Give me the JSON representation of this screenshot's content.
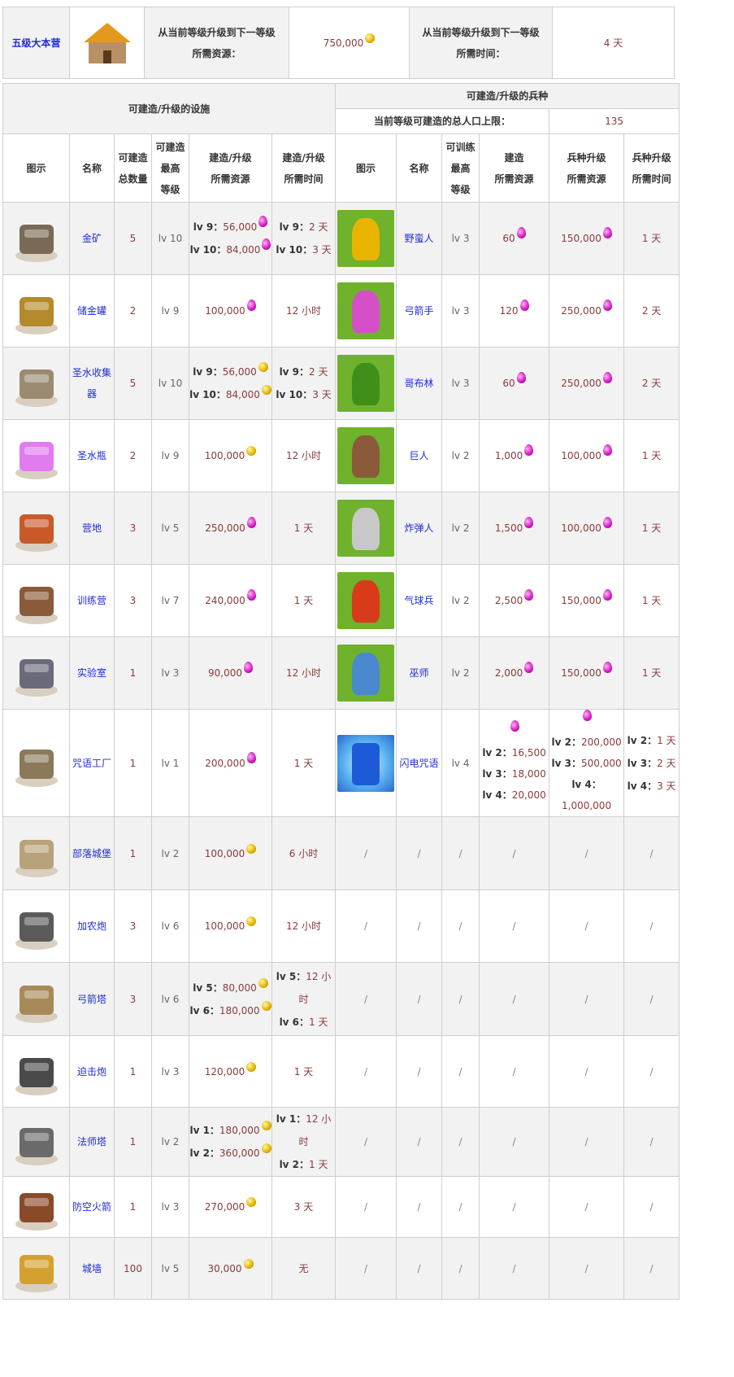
{
  "header": {
    "town_hall": "五级大本营",
    "res_label_1": "从当前等级升级到下一等级",
    "res_label_2": "所需资源：",
    "res_value": "750,000",
    "time_label_1": "从当前等级升级到下一等级",
    "time_label_2": "所需时间：",
    "time_value": "4 天"
  },
  "sections": {
    "facilities": "可建造/升级的设施",
    "troops": "可建造/升级的兵种",
    "pop_label": "当前等级可建造的总人口上限：",
    "pop_value": "135"
  },
  "columns": {
    "icon": "图示",
    "name": "名称",
    "count_1": "可建造",
    "count_2": "总数量",
    "max_1": "可建造",
    "max_2": "最高",
    "max_3": "等级",
    "cost_1": "建造/升级",
    "cost_2": "所需资源",
    "time_1": "建造/升级",
    "time_2": "所需时间",
    "t_icon": "图示",
    "t_name": "名称",
    "t_max_1": "可训练",
    "t_max_2": "最高",
    "t_max_3": "等级",
    "t_build_1": "建造",
    "t_build_2": "所需资源",
    "t_up_1": "兵种升级",
    "t_up_2": "所需资源",
    "t_time_1": "兵种升级",
    "t_time_2": "所需时间"
  },
  "rows": [
    {
      "name": "金矿",
      "count": "5",
      "max": "lv 10",
      "cost": [
        {
          "lv": "lv 9：",
          "v": "56,000",
          "r": "elixir"
        },
        {
          "lv": "lv 10：",
          "v": "84,000",
          "r": "elixir"
        }
      ],
      "time": [
        {
          "lv": "lv 9：",
          "v": "2 天"
        },
        {
          "lv": "lv 10：",
          "v": "3 天"
        }
      ],
      "troop": {
        "name": "野蛮人",
        "max": "lv 3",
        "build": "60",
        "up": "150,000",
        "time": "1 天",
        "fig": "#e8b400"
      }
    },
    {
      "name": "储金罐",
      "count": "2",
      "max": "lv 9",
      "cost": [
        {
          "v": "100,000",
          "r": "elixir"
        }
      ],
      "time": [
        {
          "v": "12 小时"
        }
      ],
      "troop": {
        "name": "弓箭手",
        "max": "lv 3",
        "build": "120",
        "up": "250,000",
        "time": "2 天",
        "fig": "#d44fc8"
      }
    },
    {
      "name": "圣水收集器",
      "count": "5",
      "max": "lv 10",
      "cost": [
        {
          "lv": "lv 9：",
          "v": "56,000",
          "r": "gold"
        },
        {
          "lv": "lv 10：",
          "v": "84,000",
          "r": "gold"
        }
      ],
      "time": [
        {
          "lv": "lv 9：",
          "v": "2 天"
        },
        {
          "lv": "lv 10：",
          "v": "3 天"
        }
      ],
      "troop": {
        "name": "哥布林",
        "max": "lv 3",
        "build": "60",
        "up": "250,000",
        "time": "2 天",
        "fig": "#3f8f1a"
      }
    },
    {
      "name": "圣水瓶",
      "count": "2",
      "max": "lv 9",
      "cost": [
        {
          "v": "100,000",
          "r": "gold"
        }
      ],
      "time": [
        {
          "v": "12 小时"
        }
      ],
      "troop": {
        "name": "巨人",
        "max": "lv 2",
        "build": "1,000",
        "up": "100,000",
        "time": "1 天",
        "fig": "#8a5a3a"
      }
    },
    {
      "name": "营地",
      "count": "3",
      "max": "lv 5",
      "cost": [
        {
          "v": "250,000",
          "r": "elixir"
        }
      ],
      "time": [
        {
          "v": "1 天"
        }
      ],
      "troop": {
        "name": "炸弹人",
        "max": "lv 2",
        "build": "1,500",
        "up": "100,000",
        "time": "1 天",
        "fig": "#c8c8c8"
      }
    },
    {
      "name": "训练营",
      "count": "3",
      "max": "lv 7",
      "cost": [
        {
          "v": "240,000",
          "r": "elixir"
        }
      ],
      "time": [
        {
          "v": "1 天"
        }
      ],
      "troop": {
        "name": "气球兵",
        "max": "lv 2",
        "build": "2,500",
        "up": "150,000",
        "time": "1 天",
        "fig": "#d83a1a"
      }
    },
    {
      "name": "实验室",
      "count": "1",
      "max": "lv 3",
      "cost": [
        {
          "v": "90,000",
          "r": "elixir"
        }
      ],
      "time": [
        {
          "v": "12 小时"
        }
      ],
      "troop": {
        "name": "巫师",
        "max": "lv 2",
        "build": "2,000",
        "up": "150,000",
        "time": "1 天",
        "fig": "#4a88d0"
      }
    }
  ],
  "spell": {
    "name": "咒语工厂",
    "count": "1",
    "max": "lv 1",
    "cost": "200,000",
    "time": "1 天",
    "troop_name": "闪电咒语",
    "troop_max": "lv 4",
    "build": [
      {
        "lv": "lv 2：",
        "v": "16,500"
      },
      {
        "lv": "lv 3：",
        "v": "18,000"
      },
      {
        "lv": "lv 4：",
        "v": "20,000"
      }
    ],
    "up": [
      {
        "lv": "lv 2：",
        "v": "200,000"
      },
      {
        "lv": "lv 3：",
        "v": "500,000"
      },
      {
        "lv": "lv 4：",
        "v": "1,000,000"
      }
    ],
    "times": [
      {
        "lv": "lv 2：",
        "v": "1 天"
      },
      {
        "lv": "lv 3：",
        "v": "2 天"
      },
      {
        "lv": "lv 4：",
        "v": "3 天"
      }
    ]
  },
  "defenses": [
    {
      "name": "部落城堡",
      "count": "1",
      "max": "lv 2",
      "cost": [
        {
          "v": "100,000",
          "r": "gold"
        }
      ],
      "time": [
        {
          "v": "6 小时"
        }
      ]
    },
    {
      "name": "加农炮",
      "count": "3",
      "max": "lv 6",
      "cost": [
        {
          "v": "100,000",
          "r": "gold"
        }
      ],
      "time": [
        {
          "v": "12 小时"
        }
      ]
    },
    {
      "name": "弓箭塔",
      "count": "3",
      "max": "lv 6",
      "cost": [
        {
          "lv": "lv 5：",
          "v": "80,000",
          "r": "gold"
        },
        {
          "lv": "lv 6：",
          "v": "180,000",
          "r": "gold"
        }
      ],
      "time": [
        {
          "lv": "lv 5：",
          "v": "12 小时"
        },
        {
          "lv": "lv 6：",
          "v": "1 天"
        }
      ]
    },
    {
      "name": "迫击炮",
      "count": "1",
      "max": "lv 3",
      "cost": [
        {
          "v": "120,000",
          "r": "gold"
        }
      ],
      "time": [
        {
          "v": "1 天"
        }
      ]
    },
    {
      "name": "法师塔",
      "count": "1",
      "max": "lv 2",
      "cost": [
        {
          "lv": "lv 1：",
          "v": "180,000",
          "r": "gold"
        },
        {
          "lv": "lv 2：",
          "v": "360,000",
          "r": "gold"
        }
      ],
      "time": [
        {
          "lv": "lv 1：",
          "v": "12 小时"
        },
        {
          "lv": "lv 2：",
          "v": "1 天"
        }
      ]
    },
    {
      "name": "防空火箭",
      "count": "1",
      "max": "lv 3",
      "cost": [
        {
          "v": "270,000",
          "r": "gold"
        }
      ],
      "time": [
        {
          "v": "3 天"
        }
      ]
    },
    {
      "name": "城墙",
      "count": "100",
      "max": "lv 5",
      "cost": [
        {
          "v": "30,000",
          "r": "gold"
        }
      ],
      "time": [
        {
          "v": "无"
        }
      ]
    }
  ],
  "slash": "/",
  "colors": {
    "link": "#1f2bd6",
    "border": "#cfcfcf",
    "stripe": "#f2f2f2"
  }
}
